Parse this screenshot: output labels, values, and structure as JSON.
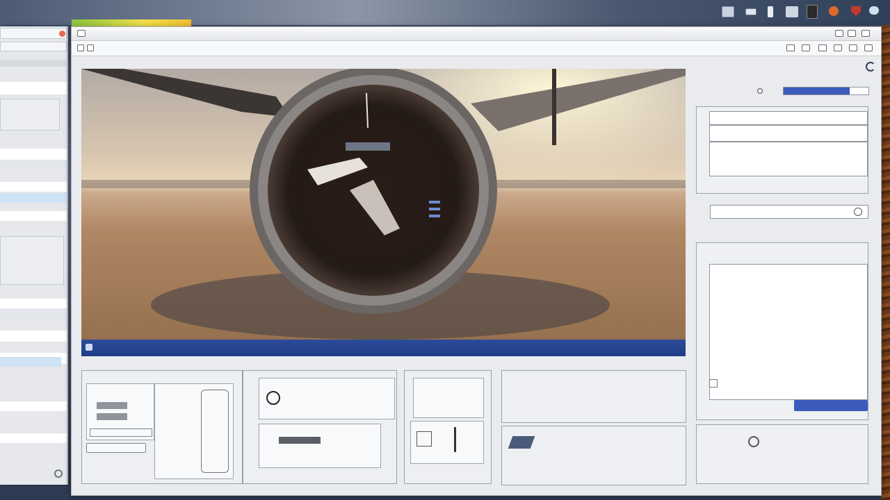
{
  "desktop": {
    "tray_icons": [
      "monitor-icon",
      "battery-icon",
      "usb-icon",
      "screen-icon",
      "printer-icon",
      "orange-app-icon",
      "red-shield-icon",
      "cloud-icon"
    ]
  },
  "left_window": {
    "top_label": "",
    "field_1": "",
    "field_2": "",
    "field_3": ""
  },
  "main_window": {
    "title": "",
    "title_right": "",
    "address": "",
    "breadcrumb": "",
    "status": {
      "left": "",
      "center": "",
      "right": "",
      "right_code": ""
    }
  },
  "right_panel": {
    "header": "",
    "progress": 0.78,
    "preview_caption_1": "",
    "preview_caption_2": "",
    "search_placeholder": "",
    "section_label": "",
    "footer_label": ""
  },
  "thumbnails": {
    "t1_header": "",
    "t1_item": "",
    "t1_side": "",
    "t1_button": "",
    "t2_caption": "",
    "t2_footer_left": "",
    "t2_footer_right": "",
    "t4_big": "",
    "t4_footer": "",
    "t5_footer": ""
  },
  "colors": {
    "accent": "#2b4c9a",
    "progress_fill": "#3b5bbd",
    "window_bg": "#e9ebee"
  }
}
